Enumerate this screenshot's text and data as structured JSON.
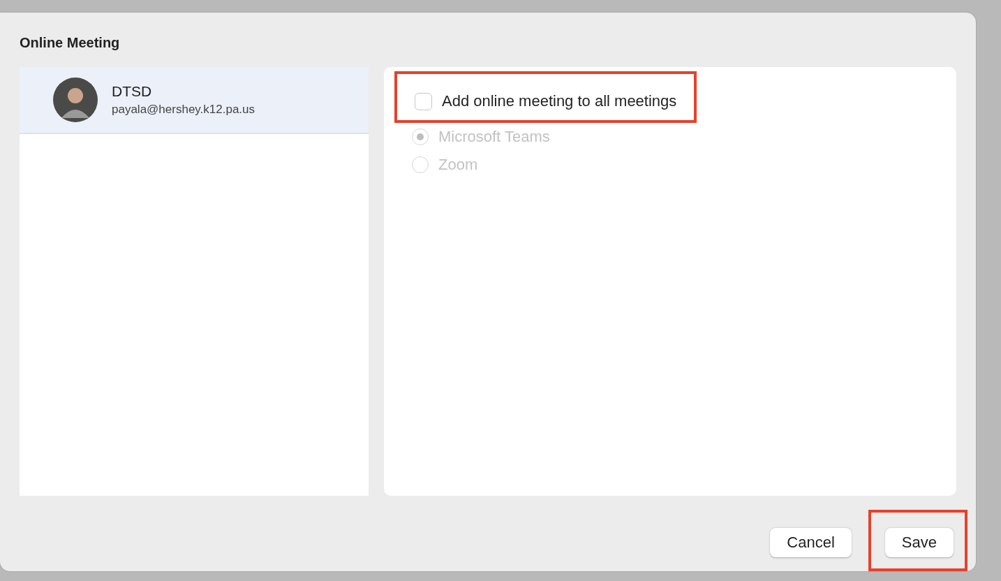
{
  "dialog": {
    "title": "Online Meeting"
  },
  "accounts": [
    {
      "name": "DTSD",
      "email": "payala@hershey.k12.pa.us",
      "selected": true
    }
  ],
  "setting": {
    "label": "Add online meeting to all meetings",
    "checked": false,
    "highlighted": true
  },
  "providers": [
    {
      "label": "Microsoft Teams",
      "selected": true,
      "disabled": true
    },
    {
      "label": "Zoom",
      "selected": false,
      "disabled": true
    }
  ],
  "buttons": [
    {
      "label": "Cancel",
      "highlighted": false
    },
    {
      "label": "Save",
      "highlighted": true
    }
  ]
}
